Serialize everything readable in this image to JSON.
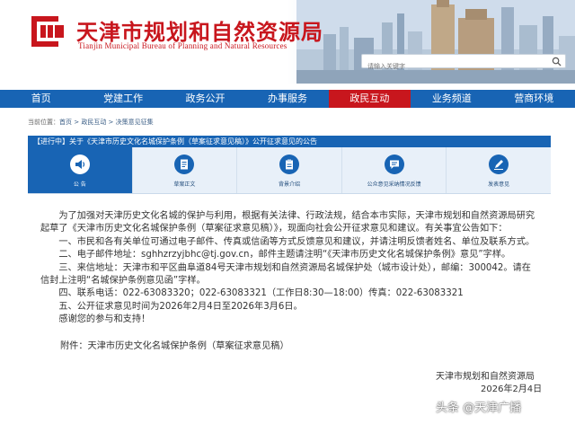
{
  "header": {
    "title_cn": "天津市规划和自然资源局",
    "title_en": "Tianjin Municipal Bureau of Planning and Natural Resources",
    "search_placeholder": "请输入关键字"
  },
  "nav": {
    "items": [
      "首页",
      "党建工作",
      "政务公开",
      "办事服务",
      "政民互动",
      "业务频道",
      "营商环境"
    ],
    "active_index": 4
  },
  "breadcrumb": {
    "home": "当前位置：",
    "items": [
      "首页",
      "政民互动",
      "决策意见征集"
    ],
    "separator": " > "
  },
  "article": {
    "title": "【进行中】关于《天津市历史文化名城保护条例（草案征求意见稿）》公开征求意见的公告"
  },
  "tabs": [
    {
      "label": "公  告",
      "icon": "speaker-icon",
      "active": true
    },
    {
      "label": "草案正文",
      "icon": "document-icon",
      "active": false
    },
    {
      "label": "背景介绍",
      "icon": "clipboard-icon",
      "active": false
    },
    {
      "label": "公众意见采纳情况反馈",
      "icon": "feedback-icon",
      "active": false
    },
    {
      "label": "发表意见",
      "icon": "pen-icon",
      "active": false
    }
  ],
  "body": {
    "lines": [
      "　　为了加强对天津历史文化名城的保护与利用，根据有关法律、行政法规，结合本市实际，天津市规划和自然资源局研究",
      "起草了《天津市历史文化名城保护条例（草案征求意见稿）》，现面向社会公开征求意见和建议。有关事宜公告如下：",
      "　　一、市民和各有关单位可通过电子邮件、传真或信函等方式反馈意见和建议，并请注明反馈者姓名、单位及联系方式。",
      "　　二、电子邮件地址：sghhzrzyjbhc@tj.gov.cn，邮件主题请注明“《天津市历史文化名城保护条例》意见”字样。",
      "　　三、来信地址：天津市和平区曲阜道84号天津市规划和自然资源局名城保护处（城市设计处），邮编：300042。请在",
      "信封上注明“名城保护条例意见函”字样。",
      "　　四、联系电话：022-63083320；022-63083321（工作日8:30—18:00）传真：022-63083321",
      "　　五、公开征求意见时间为2026年2月4日至2026年3月6日。",
      "　　感谢您的参与和支持！"
    ],
    "attachment": "附件：天津市历史文化名城保护条例（草案征求意见稿）",
    "sign_org": "天津市规划和自然资源局",
    "sign_date": "2026年2月4日"
  },
  "watermark": "头条 @天津广播",
  "colors": {
    "brand_red": "#c8161d",
    "nav_blue": "#1864b4",
    "tab_bg": "#e8f0f9"
  }
}
